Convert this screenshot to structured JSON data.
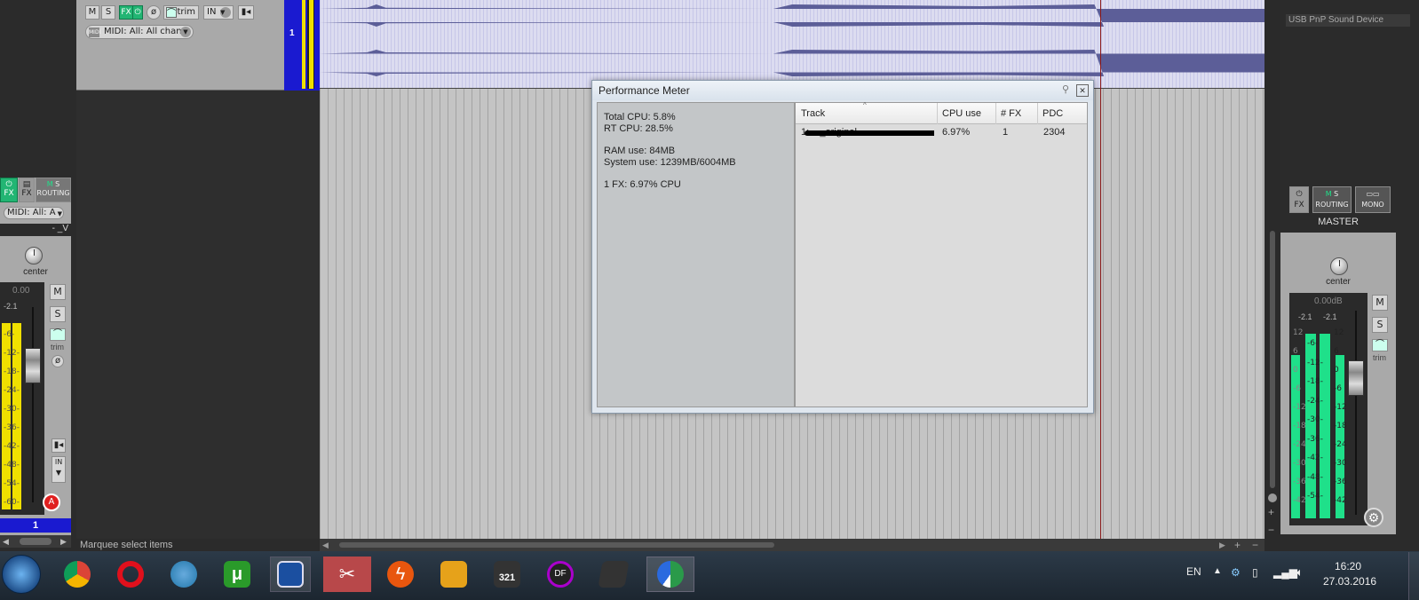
{
  "track_top": {
    "mute": "M",
    "solo": "S",
    "fx": "FX",
    "trim": "trim",
    "input": "IN",
    "midi_input": "MIDI: All: All chann",
    "track_number": "1"
  },
  "mixer_strip": {
    "fx": "FX",
    "fx2": "FX",
    "routing": "ROUTING",
    "ms": "M",
    "midi_input": "MIDI: All: A",
    "name_suffix": "- _V",
    "pan": "center",
    "volume": "0.00",
    "peak": "-2.1",
    "mute": "M",
    "solo": "S",
    "trim": "trim",
    "input": "IN",
    "arm": "A",
    "track_number": "1",
    "scale": [
      "-6-",
      "-12-",
      "-18-",
      "-24-",
      "-30-",
      "-36-",
      "-42-",
      "-48-",
      "-54-",
      "-60-"
    ]
  },
  "status": {
    "hint": "Marquee select items"
  },
  "perf_meter": {
    "title": "Performance Meter",
    "total_cpu": "Total CPU: 5.8%",
    "rt_cpu": "RT CPU: 28.5%",
    "ram_use": "RAM use: 84MB",
    "system_use": "System use: 1239MB/6004MB",
    "fx_cpu": "1 FX: 6.97% CPU",
    "columns": [
      "Track",
      "CPU use",
      "# FX",
      "PDC"
    ],
    "rows": [
      {
        "track": "1: ..._original...",
        "cpu": "6.97%",
        "fx": "1",
        "pdc": "2304"
      }
    ]
  },
  "master": {
    "device": "USB PnP Sound Device",
    "fx": "FX",
    "routing": "ROUTING",
    "mono": "MONO",
    "label": "MASTER",
    "pan": "center",
    "volume": "0.00dB",
    "peak_l": "-2.1",
    "peak_r": "-2.1",
    "mute": "M",
    "solo": "S",
    "trim": "trim",
    "scale_left": [
      "12",
      "6",
      "0",
      "-6",
      "-12",
      "-18",
      "-24",
      "-30",
      "-36",
      "-42"
    ],
    "scale_mid": [
      "-6-",
      "-12-",
      "-18-",
      "-24-",
      "-30-",
      "-36-",
      "-42-",
      "-48-",
      "-54-"
    ],
    "scale_right": [
      "12",
      "6",
      "0",
      "-6",
      "-12",
      "-18",
      "-24",
      "-30",
      "-36",
      "-42"
    ]
  },
  "taskbar": {
    "language": "EN",
    "time": "16:20",
    "date": "27.03.2016",
    "apps": [
      "chrome",
      "opera",
      "idm",
      "utorrent",
      "floppy",
      "scissors",
      "lightning",
      "winamp",
      "321",
      "dp",
      "app-x",
      "reaper"
    ]
  },
  "colors": {
    "waveform": "#5c5e98",
    "meter_yellow": "#f0e000",
    "meter_green": "#1fe08a",
    "track_blue": "#1a1ad0"
  }
}
